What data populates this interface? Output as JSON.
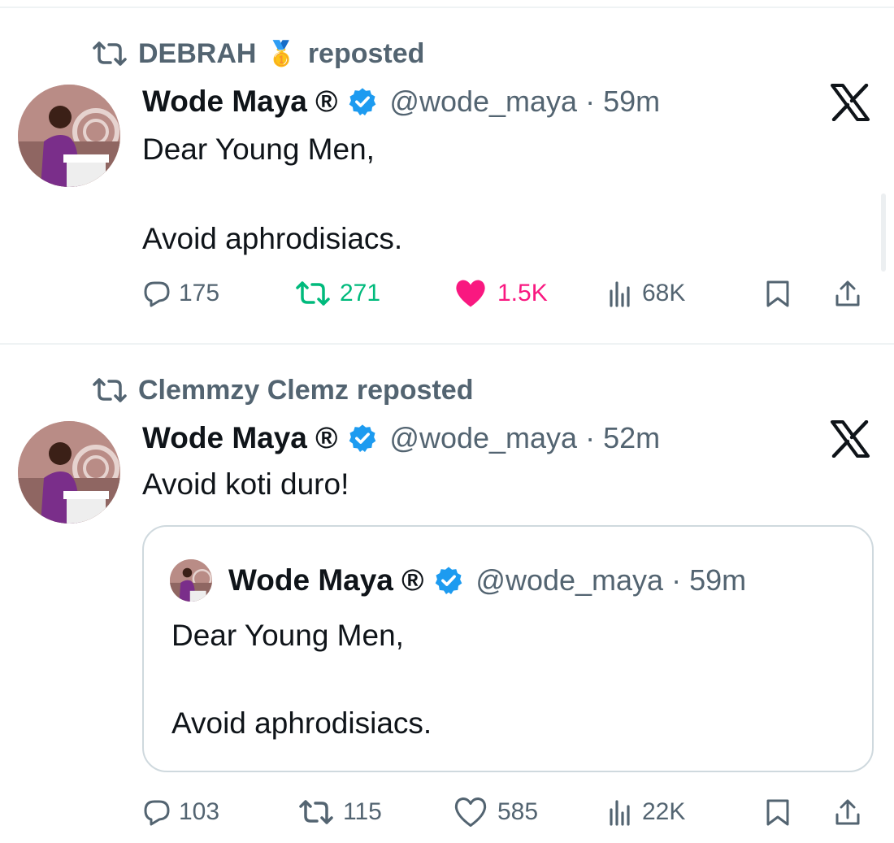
{
  "tweets": [
    {
      "reposter": "DEBRAH",
      "reposter_emoji": "🥇",
      "repost_suffix": "reposted",
      "author": "Wode Maya ®",
      "handle_time": "@wode_maya · 59m",
      "line1": "Dear Young Men,",
      "line2": "Avoid aphrodisiacs.",
      "replies": "175",
      "reposts": "271",
      "likes": "1.5K",
      "views": "68K",
      "reposted_by_me": true,
      "liked_by_me": true
    },
    {
      "reposter": "Clemmzy Clemz",
      "repost_suffix": "reposted",
      "author": "Wode Maya ®",
      "handle_time": "@wode_maya · 52m",
      "line1": "Avoid koti duro!",
      "quote": {
        "author": "Wode Maya ®",
        "handle_time": "@wode_maya · 59m",
        "line1": "Dear Young Men,",
        "line2": "Avoid aphrodisiacs."
      },
      "replies": "103",
      "reposts": "115",
      "likes": "585",
      "views": "22K",
      "reposted_by_me": false,
      "liked_by_me": false
    }
  ],
  "colors": {
    "text_primary": "#0f1419",
    "text_secondary": "#536471",
    "verified_blue": "#1d9bf0",
    "repost_green": "#00ba7c",
    "like_pink": "#f91880",
    "border": "#cfd9de"
  },
  "icons": [
    "repost-icon",
    "verified-badge-icon",
    "x-logo-icon",
    "reply-icon",
    "like-icon",
    "views-icon",
    "bookmark-icon",
    "share-icon"
  ]
}
